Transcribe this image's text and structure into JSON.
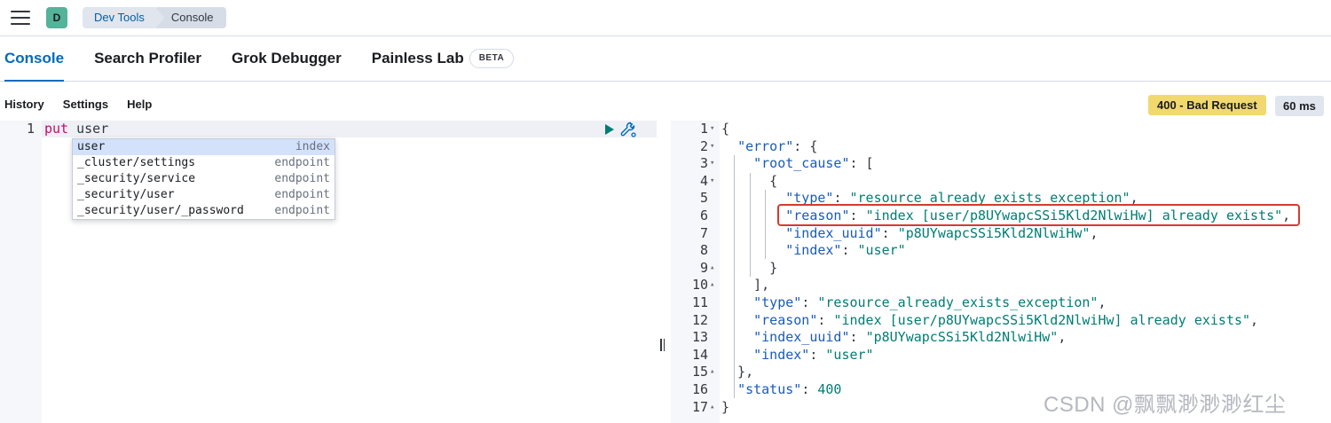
{
  "header": {
    "space_initial": "D",
    "breadcrumbs": [
      "Dev Tools",
      "Console"
    ]
  },
  "tabs": [
    {
      "label": "Console",
      "active": true
    },
    {
      "label": "Search Profiler",
      "active": false
    },
    {
      "label": "Grok Debugger",
      "active": false
    },
    {
      "label": "Painless Lab",
      "active": false,
      "badge": "BETA"
    }
  ],
  "subnav": {
    "history": "History",
    "settings": "Settings",
    "help": "Help"
  },
  "status": {
    "code_text": "400 - Bad Request",
    "time_text": "60 ms",
    "badge_color": "#f1d86f"
  },
  "request": {
    "line_number": "1",
    "method": "put",
    "url": "user"
  },
  "autocomplete": [
    {
      "name": "user",
      "type": "index",
      "selected": true
    },
    {
      "name": "_cluster/settings",
      "type": "endpoint",
      "selected": false
    },
    {
      "name": "_security/service",
      "type": "endpoint",
      "selected": false
    },
    {
      "name": "_security/user",
      "type": "endpoint",
      "selected": false
    },
    {
      "name": "_security/user/_password",
      "type": "endpoint",
      "selected": false
    }
  ],
  "response": {
    "line_numbers": [
      "1",
      "2",
      "3",
      "4",
      "5",
      "6",
      "7",
      "8",
      "9",
      "10",
      "11",
      "12",
      "13",
      "14",
      "15",
      "16",
      "17"
    ],
    "lines": [
      "{",
      "  \"error\": {",
      "    \"root_cause\": [",
      "      {",
      "        \"type\": \"resource_already_exists_exception\",",
      "        \"reason\": \"index [user/p8UYwapcSSi5Kld2NlwiHw] already exists\",",
      "        \"index_uuid\": \"p8UYwapcSSi5Kld2NlwiHw\",",
      "        \"index\": \"user\"",
      "      }",
      "    ],",
      "    \"type\": \"resource_already_exists_exception\",",
      "    \"reason\": \"index [user/p8UYwapcSSi5Kld2NlwiHw] already exists\",",
      "    \"index_uuid\": \"p8UYwapcSSi5Kld2NlwiHw\",",
      "    \"index\": \"user\"",
      "  },",
      "  \"status\": 400",
      "}"
    ],
    "fold_markers": {
      "1": "▾",
      "2": "▾",
      "3": "▾",
      "4": "▾",
      "9": "▴",
      "10": "▴",
      "15": "▴",
      "17": "▴"
    }
  },
  "watermark": "CSDN @飘飘渺渺渺红尘"
}
